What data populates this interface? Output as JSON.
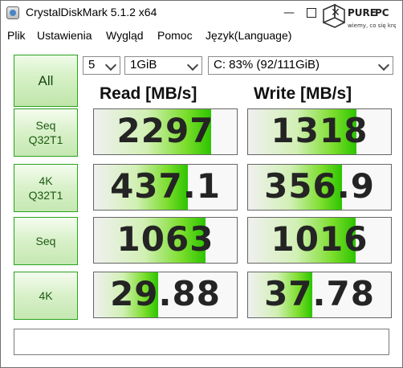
{
  "window": {
    "title": "CrystalDiskMark 5.1.2 x64"
  },
  "logo": {
    "text": "PURE PC",
    "tagline": "wiemy, co się kręci !"
  },
  "menu": [
    "Plik",
    "Ustawienia",
    "Wygląd",
    "Pomoc",
    "Język(Language)"
  ],
  "controls": {
    "all_label": "All",
    "count": "5",
    "size": "1GiB",
    "drive": "C: 83% (92/111GiB)"
  },
  "headers": {
    "read": "Read [MB/s]",
    "write": "Write [MB/s]"
  },
  "rows": [
    {
      "line1": "Seq",
      "line2": "Q32T1",
      "read": "2297",
      "write": "1318",
      "read_level": 0.82,
      "write_level": 0.76
    },
    {
      "line1": "4K",
      "line2": "Q32T1",
      "read": "437.1",
      "write": "356.9",
      "read_level": 0.66,
      "write_level": 0.66
    },
    {
      "line1": "Seq",
      "line2": "",
      "read": "1063",
      "write": "1016",
      "read_level": 0.78,
      "write_level": 0.75
    },
    {
      "line1": "4K",
      "line2": "",
      "read": "29.88",
      "write": "37.78",
      "read_level": 0.45,
      "write_level": 0.45
    }
  ],
  "status": "",
  "colors": {
    "border_green": "#2aa21d",
    "bar_green": "#2dc400",
    "text": "#242424"
  }
}
